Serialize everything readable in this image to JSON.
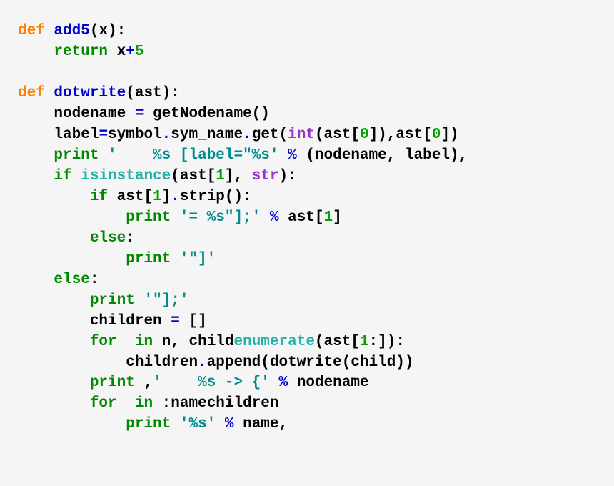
{
  "code": {
    "lines": [
      {
        "indent": 0,
        "tokens": [
          {
            "cls": "kw-orange",
            "t": "def"
          },
          {
            "cls": "",
            "t": " "
          },
          {
            "cls": "kw-blue",
            "t": "add5"
          },
          {
            "cls": "",
            "t": "("
          },
          {
            "cls": "",
            "t": "x"
          },
          {
            "cls": "",
            "t": ")"
          },
          {
            "cls": "",
            "t": ":"
          }
        ]
      },
      {
        "indent": 1,
        "tokens": [
          {
            "cls": "kw-green",
            "t": "return"
          },
          {
            "cls": "",
            "t": " x"
          },
          {
            "cls": "kw-blue",
            "t": "+"
          },
          {
            "cls": "num-green",
            "t": "5"
          }
        ]
      },
      {
        "indent": 0,
        "tokens": [
          {
            "cls": "",
            "t": ""
          }
        ]
      },
      {
        "indent": 0,
        "tokens": [
          {
            "cls": "kw-orange",
            "t": "def"
          },
          {
            "cls": "",
            "t": " "
          },
          {
            "cls": "kw-blue",
            "t": "dotwrite"
          },
          {
            "cls": "",
            "t": "(ast):"
          }
        ]
      },
      {
        "indent": 1,
        "tokens": [
          {
            "cls": "",
            "t": "nodename "
          },
          {
            "cls": "kw-blue",
            "t": "="
          },
          {
            "cls": "",
            "t": " getNodename()"
          }
        ]
      },
      {
        "indent": 1,
        "tokens": [
          {
            "cls": "",
            "t": "label"
          },
          {
            "cls": "kw-blue",
            "t": "="
          },
          {
            "cls": "",
            "t": "symbol"
          },
          {
            "cls": "kw-blue",
            "t": "."
          },
          {
            "cls": "",
            "t": "sym_name"
          },
          {
            "cls": "kw-blue",
            "t": "."
          },
          {
            "cls": "",
            "t": "get("
          },
          {
            "cls": "kw-purple",
            "t": "int"
          },
          {
            "cls": "",
            "t": "(ast["
          },
          {
            "cls": "num-green",
            "t": "0"
          },
          {
            "cls": "",
            "t": "]),ast["
          },
          {
            "cls": "num-green",
            "t": "0"
          },
          {
            "cls": "",
            "t": "])"
          }
        ]
      },
      {
        "indent": 1,
        "tokens": [
          {
            "cls": "kw-green",
            "t": "print"
          },
          {
            "cls": "",
            "t": " "
          },
          {
            "cls": "str-teal",
            "t": "'    %s [label=\"%s'"
          },
          {
            "cls": "",
            "t": " "
          },
          {
            "cls": "kw-blue",
            "t": "%"
          },
          {
            "cls": "",
            "t": " (nodename, label),"
          }
        ]
      },
      {
        "indent": 1,
        "tokens": [
          {
            "cls": "kw-green",
            "t": "if"
          },
          {
            "cls": "",
            "t": " "
          },
          {
            "cls": "kw-teal",
            "t": "isinstance"
          },
          {
            "cls": "",
            "t": "(ast["
          },
          {
            "cls": "num-green",
            "t": "1"
          },
          {
            "cls": "",
            "t": "], "
          },
          {
            "cls": "kw-purple",
            "t": "str"
          },
          {
            "cls": "",
            "t": "):"
          }
        ]
      },
      {
        "indent": 2,
        "tokens": [
          {
            "cls": "kw-green",
            "t": "if"
          },
          {
            "cls": "",
            "t": " ast["
          },
          {
            "cls": "num-green",
            "t": "1"
          },
          {
            "cls": "",
            "t": "]"
          },
          {
            "cls": "kw-blue",
            "t": "."
          },
          {
            "cls": "",
            "t": "strip():"
          }
        ]
      },
      {
        "indent": 3,
        "tokens": [
          {
            "cls": "kw-green",
            "t": "print"
          },
          {
            "cls": "",
            "t": " "
          },
          {
            "cls": "str-teal",
            "t": "'= %s\"];'"
          },
          {
            "cls": "",
            "t": " "
          },
          {
            "cls": "kw-blue",
            "t": "%"
          },
          {
            "cls": "",
            "t": " ast["
          },
          {
            "cls": "num-green",
            "t": "1"
          },
          {
            "cls": "",
            "t": "]"
          }
        ]
      },
      {
        "indent": 2,
        "tokens": [
          {
            "cls": "kw-green",
            "t": "else"
          },
          {
            "cls": "",
            "t": ":"
          }
        ]
      },
      {
        "indent": 3,
        "tokens": [
          {
            "cls": "kw-green",
            "t": "print"
          },
          {
            "cls": "",
            "t": " "
          },
          {
            "cls": "str-teal",
            "t": "'\"]'"
          }
        ]
      },
      {
        "indent": 1,
        "tokens": [
          {
            "cls": "kw-green",
            "t": "else"
          },
          {
            "cls": "",
            "t": ":"
          }
        ]
      },
      {
        "indent": 2,
        "tokens": [
          {
            "cls": "kw-green",
            "t": "print"
          },
          {
            "cls": "",
            "t": " "
          },
          {
            "cls": "str-teal",
            "t": "'\"];'"
          }
        ]
      },
      {
        "indent": 2,
        "tokens": [
          {
            "cls": "",
            "t": "children "
          },
          {
            "cls": "kw-blue",
            "t": "="
          },
          {
            "cls": "",
            "t": " []"
          }
        ]
      },
      {
        "indent": 2,
        "tokens": [
          {
            "cls": "kw-green",
            "t": "for"
          },
          {
            "cls": "",
            "t": "  "
          },
          {
            "cls": "kw-green",
            "t": "in"
          },
          {
            "cls": "",
            "t": " n, child"
          },
          {
            "cls": "kw-teal",
            "t": "enumerate"
          },
          {
            "cls": "",
            "t": "(ast["
          },
          {
            "cls": "num-green",
            "t": "1"
          },
          {
            "cls": "",
            "t": ":]):"
          }
        ]
      },
      {
        "indent": 3,
        "tokens": [
          {
            "cls": "",
            "t": "children"
          },
          {
            "cls": "kw-blue",
            "t": "."
          },
          {
            "cls": "",
            "t": "append(dotwrite(child))"
          }
        ]
      },
      {
        "indent": 2,
        "tokens": [
          {
            "cls": "kw-green",
            "t": "print"
          },
          {
            "cls": "",
            "t": " ,"
          },
          {
            "cls": "str-teal",
            "t": "'    %s -> {'"
          },
          {
            "cls": "",
            "t": " "
          },
          {
            "cls": "kw-blue",
            "t": "%"
          },
          {
            "cls": "",
            "t": " nodename"
          }
        ]
      },
      {
        "indent": 2,
        "tokens": [
          {
            "cls": "kw-green",
            "t": "for"
          },
          {
            "cls": "",
            "t": "  "
          },
          {
            "cls": "kw-green",
            "t": "in"
          },
          {
            "cls": "",
            "t": " :namechildren"
          }
        ]
      },
      {
        "indent": 3,
        "tokens": [
          {
            "cls": "kw-green",
            "t": "print"
          },
          {
            "cls": "",
            "t": " "
          },
          {
            "cls": "str-teal",
            "t": "'%s'"
          },
          {
            "cls": "",
            "t": " "
          },
          {
            "cls": "kw-blue",
            "t": "%"
          },
          {
            "cls": "",
            "t": " name,"
          }
        ]
      }
    ],
    "indent_unit": "    "
  }
}
